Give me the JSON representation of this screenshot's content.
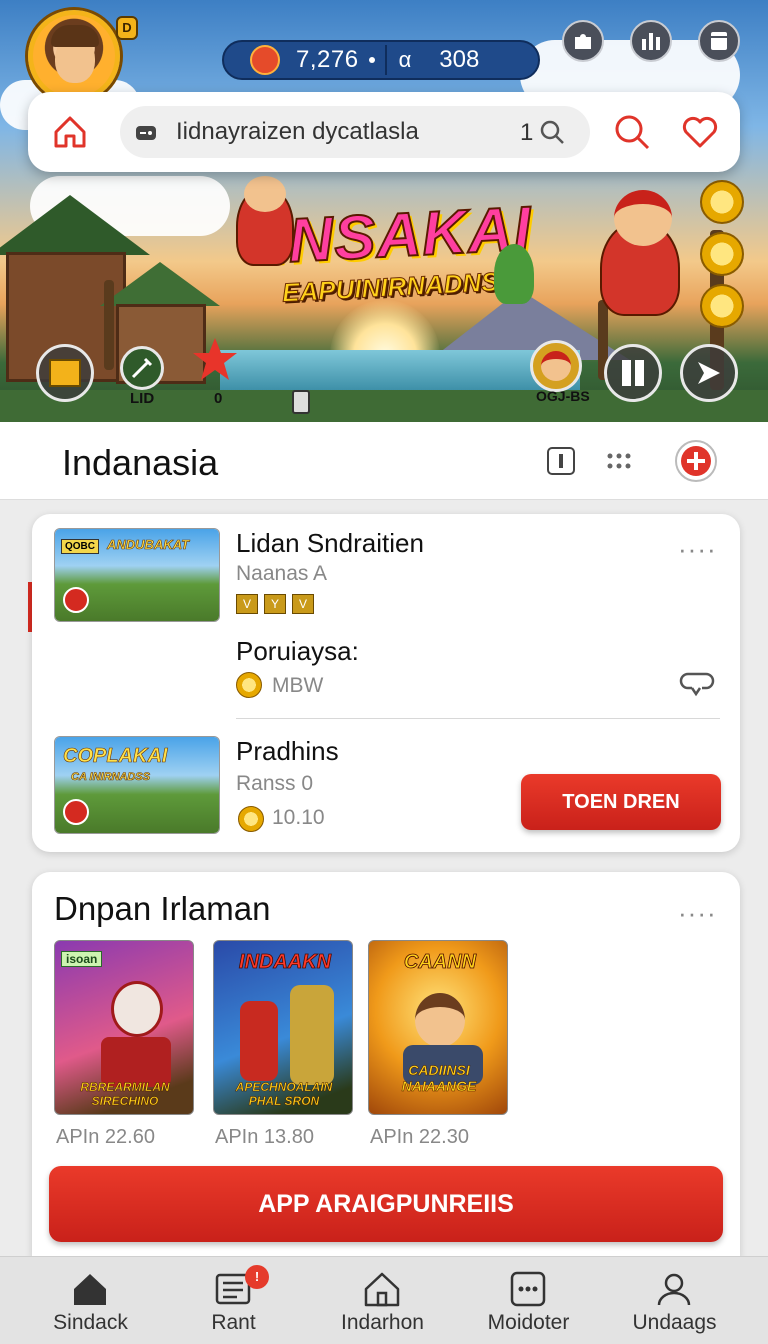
{
  "header": {
    "avatar_badge": "D",
    "coins": "7,276",
    "gems_symbol": "α",
    "gems": "308"
  },
  "search": {
    "value": "Iidnayraizen dycatlasla",
    "result_count": "1"
  },
  "banner": {
    "title": "INSAKAI",
    "subtitle": "EAPUINIRNADNS",
    "label_left": "LID",
    "label_mid": "0",
    "label_right": "OGJ-BS"
  },
  "section": {
    "title": "Indanasia"
  },
  "featured": {
    "items": [
      {
        "thumb_text": "ANDUBAKAT",
        "thumb_tag": "QOBC",
        "title": "Lidan Sndraitien",
        "subtitle": "Naanas A",
        "ranks": [
          "V",
          "Y",
          "V"
        ],
        "more": "····"
      },
      {
        "title": "Poruiaysa:",
        "price": "MBW"
      },
      {
        "thumb_text": "COPLAKAI",
        "thumb_sub": "CA INIRNADSS",
        "title": "Pradhins",
        "subtitle": "Ranss 0",
        "price": "10.10",
        "button": "TOEN DREN"
      }
    ]
  },
  "popular": {
    "title": "Dnpan Irlaman",
    "more": "····",
    "games": [
      {
        "title": "",
        "tag": "isoan",
        "bottom": "RBREARMILAN SIRECHINO",
        "price": "APIn 22.60",
        "color": "#b04a8a"
      },
      {
        "title": "INDAAKN",
        "bottom": "APECHNOALAIN PHAL SRON",
        "price": "APIn 13.80",
        "color": "#3a5aa8"
      },
      {
        "title": "CAANN",
        "bottom": "CADIINSI NAIAANGE",
        "price": "APIn 22.30",
        "color": "#d9821a"
      }
    ],
    "cta": "APP ARAIGPUNREIIS"
  },
  "nav": {
    "items": [
      {
        "label": "Sindack",
        "icon": "home-icon"
      },
      {
        "label": "Rant",
        "icon": "list-icon",
        "badge": "!"
      },
      {
        "label": "Indarhon",
        "icon": "house-outline-icon"
      },
      {
        "label": "Moidoter",
        "icon": "dots-box-icon"
      },
      {
        "label": "Undaags",
        "icon": "user-icon"
      }
    ]
  },
  "colors": {
    "accent": "#d32a20",
    "coin": "#e6a800"
  }
}
